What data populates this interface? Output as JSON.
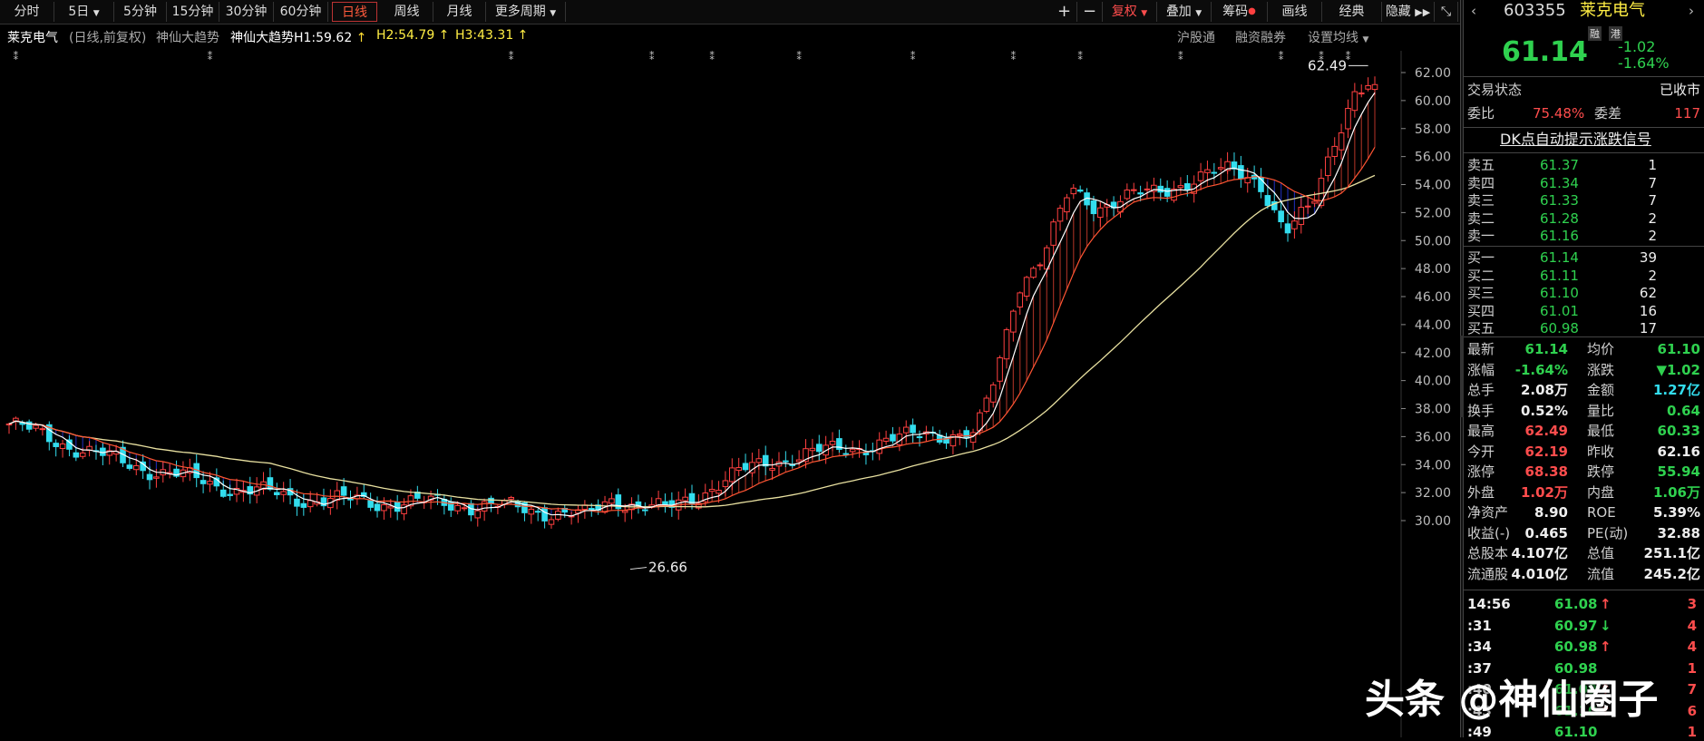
{
  "toolbar": {
    "tabs": [
      "分时",
      "5日",
      "5分钟",
      "15分钟",
      "30分钟",
      "60分钟",
      "日线",
      "周线",
      "月线",
      "更多周期"
    ],
    "active_tab": "日线",
    "right": [
      "+",
      "−",
      "复权",
      "叠加",
      "筹码",
      "画线",
      "经典",
      "隐藏"
    ]
  },
  "infobar": {
    "stock": "莱克电气",
    "mode": "(日线,前复权)",
    "indicator": "神仙大趋势",
    "indicator_full": "神仙大趋势H1:59.62",
    "h2": "H2:54.79",
    "h3": "H3:43.31",
    "links": [
      "沪股通",
      "融资融券",
      "设置均线"
    ]
  },
  "chart_data": {
    "type": "candlestick",
    "y_ticks": [
      "62.00",
      "60.00",
      "58.00",
      "56.00",
      "54.00",
      "52.00",
      "50.00",
      "48.00",
      "46.00",
      "44.00",
      "42.00",
      "40.00",
      "38.00",
      "36.00",
      "34.00",
      "32.00",
      "30.00"
    ],
    "ylim": [
      29.5,
      63.2
    ],
    "high_label": "62.49",
    "low_label": "26.66",
    "colors": {
      "up": "#ff4040",
      "down": "#33ddee",
      "fast": "#ffffff",
      "mid": "#ff5533",
      "slow": "#e8e0a0",
      "blue": "#3355ff"
    }
  },
  "panel": {
    "code": "603355",
    "name": "莱克电气",
    "badges": [
      "融",
      "港"
    ],
    "price": "61.14",
    "change": "-1.02",
    "change_pct": "-1.64%",
    "trade_state_label": "交易状态",
    "trade_state": "已收市",
    "weibi_label": "委比",
    "weibi": "75.48%",
    "weicha_label": "委差",
    "weicha": "117",
    "signal": "DK点自动提示涨跌信号",
    "asks": [
      {
        "label": "卖五",
        "price": "61.37",
        "vol": "1"
      },
      {
        "label": "卖四",
        "price": "61.34",
        "vol": "7"
      },
      {
        "label": "卖三",
        "price": "61.33",
        "vol": "7"
      },
      {
        "label": "卖二",
        "price": "61.28",
        "vol": "2"
      },
      {
        "label": "卖一",
        "price": "61.16",
        "vol": "2"
      }
    ],
    "bids": [
      {
        "label": "买一",
        "price": "61.14",
        "vol": "39"
      },
      {
        "label": "买二",
        "price": "61.11",
        "vol": "2"
      },
      {
        "label": "买三",
        "price": "61.10",
        "vol": "62"
      },
      {
        "label": "买四",
        "price": "61.01",
        "vol": "16"
      },
      {
        "label": "买五",
        "price": "60.98",
        "vol": "17"
      }
    ],
    "stats": [
      {
        "l1": "最新",
        "v1": "61.14",
        "c1": "green",
        "l2": "均价",
        "v2": "61.10",
        "c2": "green"
      },
      {
        "l1": "涨幅",
        "v1": "-1.64%",
        "c1": "green",
        "l2": "涨跌",
        "v2": "▼1.02",
        "c2": "green"
      },
      {
        "l1": "总手",
        "v1": "2.08万",
        "c1": "white",
        "l2": "金额",
        "v2": "1.27亿",
        "c2": "cyan"
      },
      {
        "l1": "换手",
        "v1": "0.52%",
        "c1": "white",
        "l2": "量比",
        "v2": "0.64",
        "c2": "green"
      },
      {
        "l1": "最高",
        "v1": "62.49",
        "c1": "red",
        "l2": "最低",
        "v2": "60.33",
        "c2": "green"
      },
      {
        "l1": "今开",
        "v1": "62.19",
        "c1": "red",
        "l2": "昨收",
        "v2": "62.16",
        "c2": "white"
      },
      {
        "l1": "涨停",
        "v1": "68.38",
        "c1": "red",
        "l2": "跌停",
        "v2": "55.94",
        "c2": "green"
      },
      {
        "l1": "外盘",
        "v1": "1.02万",
        "c1": "red",
        "l2": "内盘",
        "v2": "1.06万",
        "c2": "green"
      },
      {
        "l1": "净资产",
        "v1": "8.90",
        "c1": "white",
        "l2": "ROE",
        "v2": "5.39%",
        "c2": "white"
      },
      {
        "l1": "收益(-)",
        "v1": "0.465",
        "c1": "white",
        "l2": "PE(动)",
        "v2": "32.88",
        "c2": "white"
      },
      {
        "l1": "总股本",
        "v1": "4.107亿",
        "c1": "white",
        "l2": "总值",
        "v2": "251.1亿",
        "c2": "white"
      },
      {
        "l1": "流通股",
        "v1": "4.010亿",
        "c1": "white",
        "l2": "流值",
        "v2": "245.2亿",
        "c2": "white"
      }
    ],
    "ticks": [
      {
        "time": "14:56",
        "price": "61.08",
        "arrow": "↑",
        "ac": "red",
        "vol": "3"
      },
      {
        "time": ":31",
        "price": "60.97",
        "arrow": "↓",
        "ac": "green",
        "vol": "4"
      },
      {
        "time": ":34",
        "price": "60.98",
        "arrow": "↑",
        "ac": "red",
        "vol": "4"
      },
      {
        "time": ":37",
        "price": "60.98",
        "arrow": "",
        "ac": "red",
        "vol": "1"
      },
      {
        "time": ":40",
        "price": "61.09",
        "arrow": "↑",
        "ac": "red",
        "vol": "7"
      },
      {
        "time": ":43",
        "price": "61.10",
        "arrow": "↑",
        "ac": "red",
        "vol": "6"
      },
      {
        "time": ":49",
        "price": "61.10",
        "arrow": "",
        "ac": "red",
        "vol": "1"
      }
    ]
  },
  "watermark": "头条 @神仙圈子"
}
